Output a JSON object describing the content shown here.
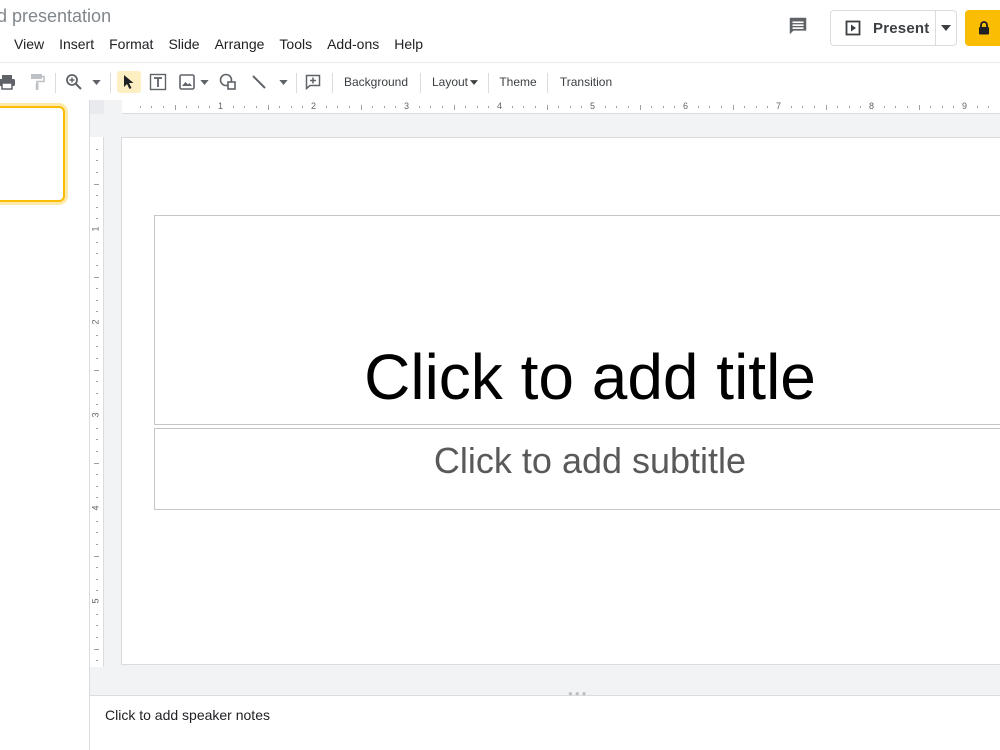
{
  "app": {
    "doc_title": "d presentation"
  },
  "menu": [
    "View",
    "Insert",
    "Format",
    "Slide",
    "Arrange",
    "Tools",
    "Add-ons",
    "Help"
  ],
  "header": {
    "present_label": "Present",
    "comment_icon": "comment-icon",
    "share_icon": "lock-icon",
    "accent_color": "#fbbc04"
  },
  "toolbar": {
    "background_label": "Background",
    "layout_label": "Layout",
    "theme_label": "Theme",
    "transition_label": "Transition",
    "icons": [
      "print-icon",
      "paint-format-icon",
      "zoom-icon",
      "select-icon",
      "textbox-icon",
      "image-icon",
      "shape-icon",
      "line-icon",
      "new-comment-icon"
    ]
  },
  "rulers": {
    "horizontal": [
      "1",
      "2",
      "3",
      "4",
      "5",
      "6",
      "7",
      "8",
      "9"
    ],
    "vertical": [
      "1",
      "2",
      "3",
      "4",
      "5"
    ]
  },
  "slide": {
    "title_placeholder": "Click to add title",
    "subtitle_placeholder": "Click to add subtitle"
  },
  "notes": {
    "placeholder": "Click to add speaker notes"
  }
}
